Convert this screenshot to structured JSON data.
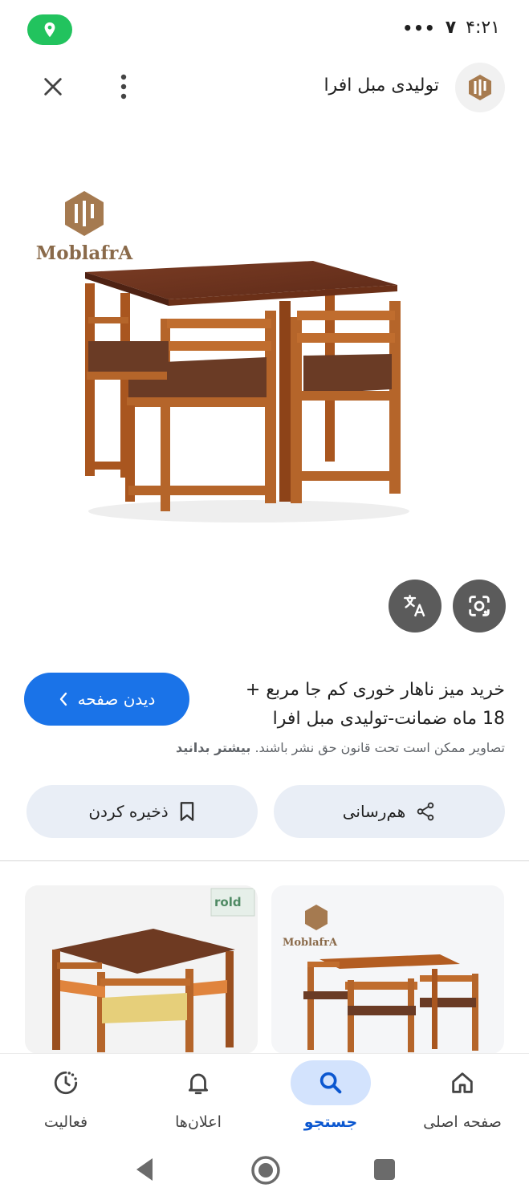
{
  "status_bar": {
    "time": "۴:۲۱",
    "signal_label": "۷",
    "overflow": "•••"
  },
  "header": {
    "site_title": "تولیدی مبل افرا"
  },
  "image": {
    "brand_text": "MoblafrA"
  },
  "result": {
    "title": "خرید میز ناهار خوری کم جا مربع + 18 ماه ضمانت-تولیدی مبل افرا",
    "visit_label": "دیدن صفحه",
    "copyright_text": "تصاویر ممکن است تحت قانون حق نشر باشند.",
    "learn_more": "بیشتر بدانید"
  },
  "actions": {
    "share_label": "هم‌رسانی",
    "save_label": "ذخیره کردن"
  },
  "thumbnails": {
    "left_watermark": "rold",
    "right_brand": "MoblafrA"
  },
  "bottom_nav": {
    "items": [
      {
        "label": "صفحه اصلی",
        "icon": "home-icon"
      },
      {
        "label": "جستجو",
        "icon": "search-icon",
        "active": true
      },
      {
        "label": "اعلان‌ها",
        "icon": "bell-icon"
      },
      {
        "label": "فعالیت",
        "icon": "activity-icon"
      }
    ]
  },
  "colors": {
    "accent": "#1a73e8",
    "pill_bg": "#e9eef6",
    "active_nav": "#d3e3fd",
    "location_pill": "#22c35e",
    "wood": "#b5652a"
  }
}
